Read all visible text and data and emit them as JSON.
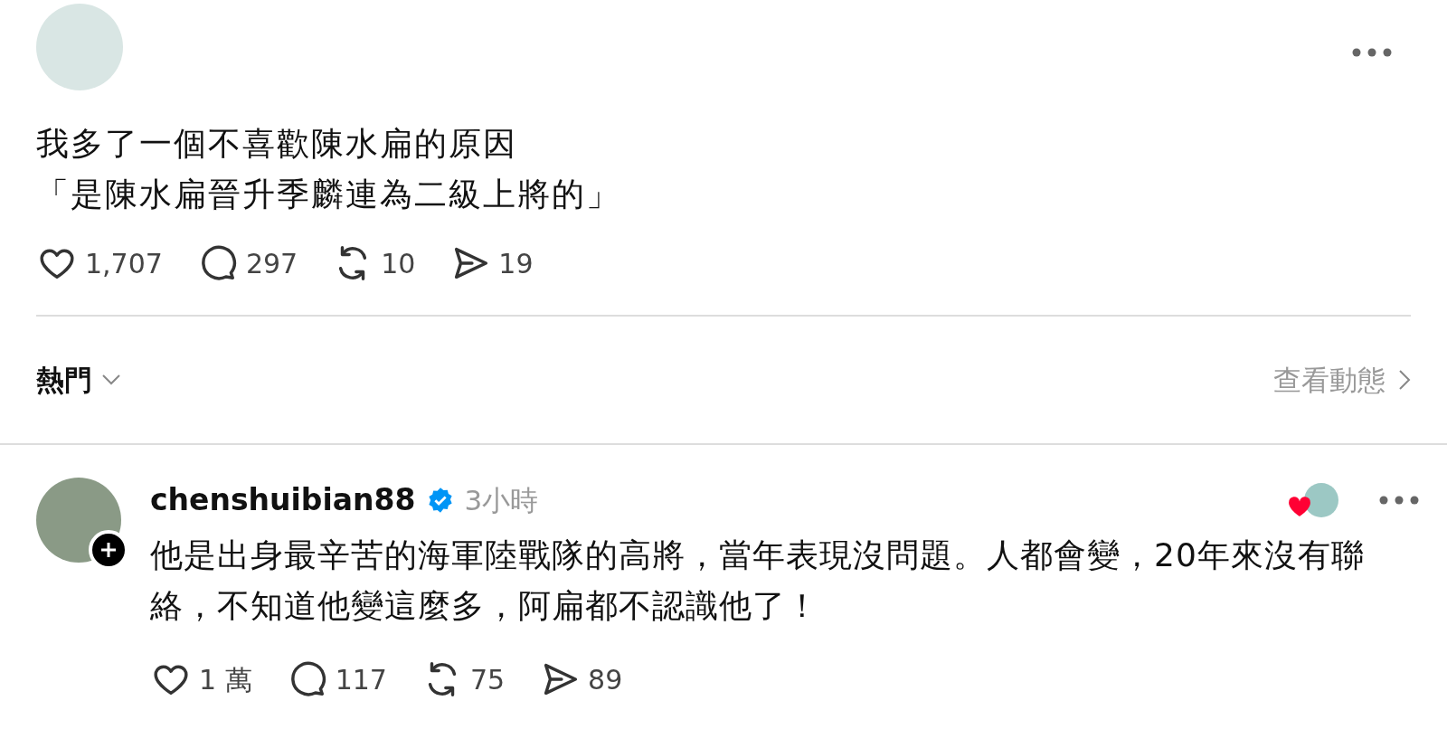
{
  "post": {
    "text_lines": [
      "我多了一個不喜歡陳水扁的原因",
      "「是陳水扁晉升季麟連為二級上將的」"
    ],
    "metrics": [
      {
        "kind": "like",
        "count": "1,707"
      },
      {
        "kind": "reply",
        "count": "297"
      },
      {
        "kind": "repost",
        "count": "10"
      },
      {
        "kind": "share",
        "count": "19"
      }
    ]
  },
  "sort_bar": {
    "sort": "熱門",
    "activity_link": "查看動態"
  },
  "replies": [
    {
      "username": "chenshuibian88",
      "verified": true,
      "time": "3小時",
      "liked_by_author": true,
      "text": "他是出身最辛苦的海軍陸戰隊的高將，當年表現沒問題。人都會變，20年來沒有聯絡，不知道他變這麼多，阿扁都不認識他了！",
      "metrics": [
        {
          "kind": "like",
          "count": "1 萬"
        },
        {
          "kind": "reply",
          "count": "117"
        },
        {
          "kind": "repost",
          "count": "75"
        },
        {
          "kind": "share",
          "count": "89"
        }
      ]
    }
  ]
}
